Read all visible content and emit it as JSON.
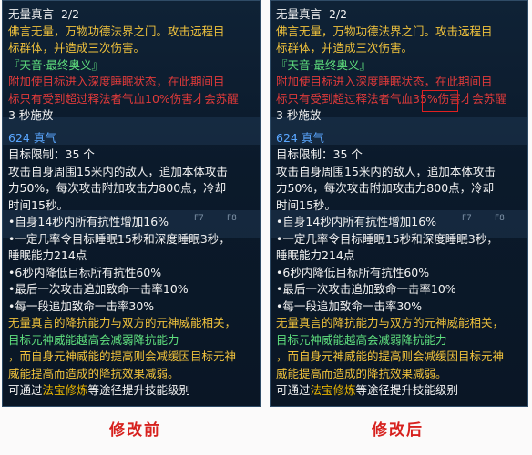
{
  "panels": [
    {
      "title": "无量真言",
      "level": "2/2",
      "desc": [
        "佛言无量，万物功德法界之门。攻击远程目",
        "标群体，并造成三次伤害。"
      ],
      "tag": "『天音·最终奥义』",
      "effect": [
        "附加使目标进入深度睡眠状态，在此期间目",
        "标只有受到超过释法者气血10%伤害才会苏醒"
      ],
      "cast": "3 秒施放",
      "chi": "624 真气",
      "limit": "目标限制：35 个",
      "attack": [
        "攻击自身周围15米内的敌人，追加本体攻击",
        "力50%，每次攻击附加攻击力800点，冷却",
        "时间15秒。"
      ],
      "buffs": [
        "•自身14秒内所有抗性增加16%",
        "•一定几率令目标睡眠15秒和深度睡眠3秒，",
        "睡眠能力214点",
        "•6秒内降低目标所有抗性60%",
        "•最后一次攻击追加致命一击率10%",
        "•每一段追加致命一击率30%"
      ],
      "note": [
        "无量真言的降抗能力与双方的元神威能相关，",
        "目标元神威能越高会减弱降抗能力",
        "，而自身元神威能的提高则会减缓因目标元神",
        "威能提高而造成的降抗效果减弱。"
      ],
      "footer_prefix": "可通过",
      "footer_link": "法宝修炼",
      "footer_suffix": "等途径提升技能级别"
    },
    {
      "title": "无量真言",
      "level": "2/2",
      "desc": [
        "佛言无量，万物功德法界之门。攻击远程目",
        "标群体，并造成三次伤害。"
      ],
      "tag": "『天音·最终奥义』",
      "effect": [
        "附加使目标进入深度睡眠状态，在此期间目",
        "标只有受到超过释法者气血35%伤害才会苏醒"
      ],
      "cast": "3 秒施放",
      "chi": "624 真气",
      "limit": "目标限制：35 个",
      "attack": [
        "攻击自身周围15米内的敌人，追加本体攻击",
        "力50%，每次攻击附加攻击力800点，冷却",
        "时间15秒。"
      ],
      "buffs": [
        "•自身14秒内所有抗性增加16%",
        "•一定几率令目标睡眠15秒和深度睡眠3秒，",
        "睡眠能力214点",
        "•6秒内降低目标所有抗性60%",
        "•最后一次攻击追加致命一击率10%",
        "•每一段追加致命一击率30%"
      ],
      "note": [
        "无量真言的降抗能力与双方的元神威能相关，",
        "目标元神威能越高会减弱降抗能力",
        "，而自身元神威能的提高则会减缓因目标元神",
        "威能提高而造成的降抗效果减弱。"
      ],
      "footer_prefix": "可通过",
      "footer_link": "法宝修炼",
      "footer_suffix": "等途径提升技能级别"
    }
  ],
  "captions": {
    "left": "修改前",
    "right": "修改后"
  },
  "fkeys": [
    "F7",
    "F8"
  ],
  "colors": {
    "highlight": "#e02020",
    "accent_yellow": "#f0c23c",
    "accent_green": "#5fe07e",
    "accent_red": "#e03a3a"
  }
}
